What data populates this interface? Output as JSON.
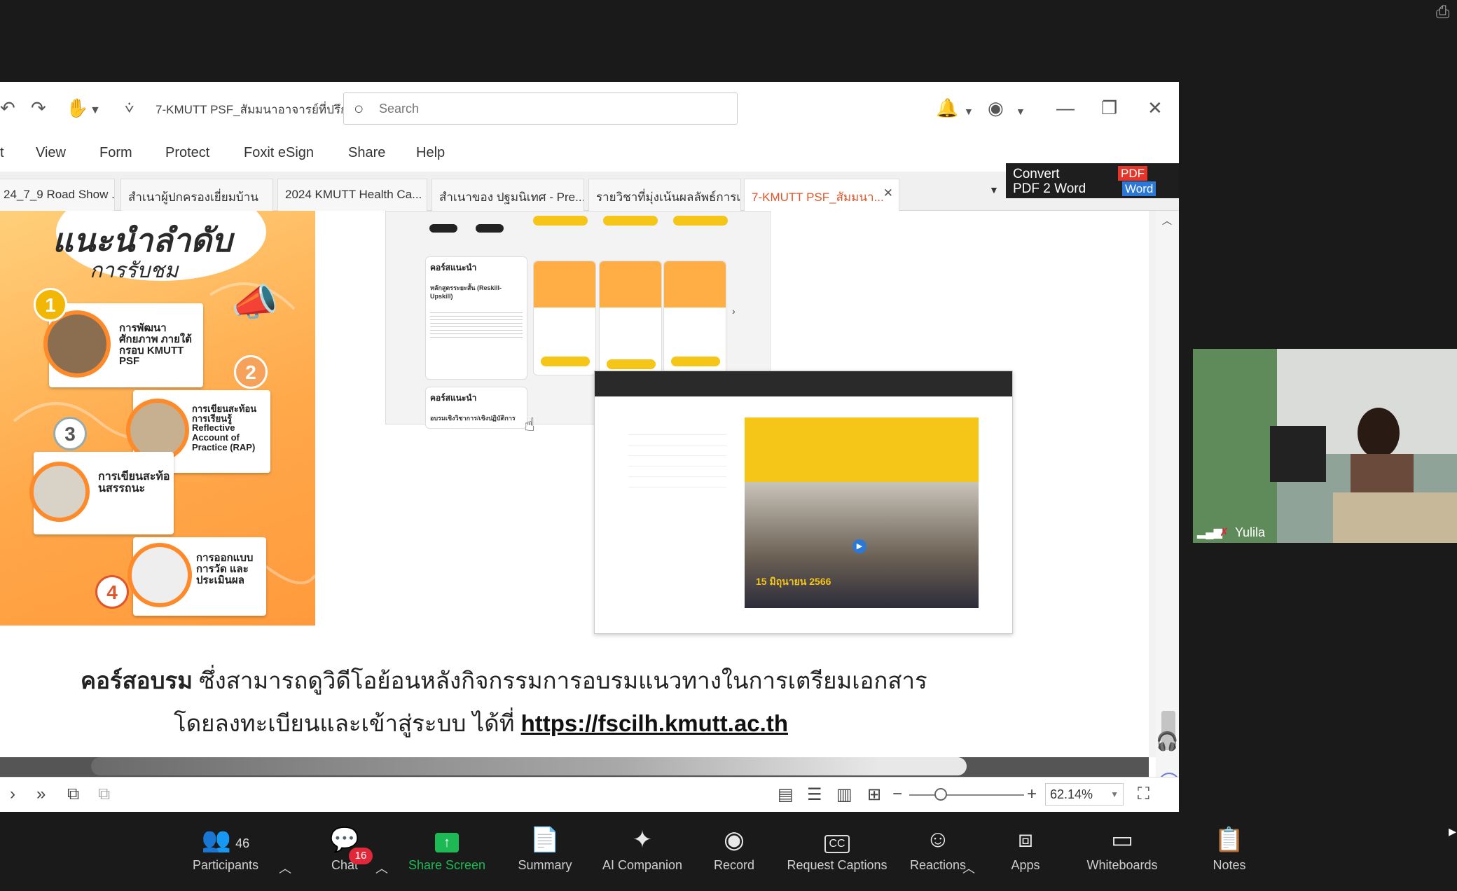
{
  "app": {
    "doc_title": "7-KMUTT PSF_สัมมนาอาจารย์ที่ปรึก...",
    "search_placeholder": "Search"
  },
  "menu": [
    "t",
    "View",
    "Form",
    "Protect",
    "Foxit eSign",
    "Share",
    "Help"
  ],
  "tabs": [
    {
      "label": "24_7_9 Road Show ..."
    },
    {
      "label": "สำเนาผู้ปกครองเยี่ยมบ้าน"
    },
    {
      "label": "2024 KMUTT Health Ca..."
    },
    {
      "label": "สำเนาของ ปฐมนิเทศ - Pre..."
    },
    {
      "label": "รายวิชาที่มุ่งเน้นผลลัพธ์การเ..."
    },
    {
      "label": "7-KMUTT PSF_สัมมนา...",
      "active": true
    }
  ],
  "convert_ad": {
    "line1": "Convert",
    "line2": "PDF 2 Word",
    "pdf": "PDF",
    "word": "Word"
  },
  "poster": {
    "title": "แนะนำลำดับ",
    "subtitle": "การรับชม",
    "card1": "การพัฒนาศักยภาพ ภายใต้กรอบ KMUTT PSF",
    "card2": "การเขียนสะท้อนการเรียนรู้ Reflective Account of Practice (RAP)",
    "card3": "การเขียนสะท้อนสรรถนะ",
    "card4": "การออกแบบการวัด และประเมินผล",
    "nums": [
      "1",
      "2",
      "3",
      "4"
    ]
  },
  "web1": {
    "heading1": "คอร์สแนะนำ",
    "sub1": "หลักสูตรระยะสั้น (Reskill-Upskill)",
    "heading2": "คอร์สแนะนำ",
    "sub2": "อบรมเชิงวิชาการ/เชิงปฏิบัติการ"
  },
  "web2": {
    "date_overlay": "15 มิถุนายน 2566"
  },
  "caption": {
    "bold": "คอร์สอบรม",
    "rest1": " ซึ่งสามารถดูวิดีโอย้อนหลังกิจกรรมการอบรมแนวทางในการเตรียมเอกสาร",
    "rest2": "โดยลงทะเบียนและเข้าสู่ระบบ ได้ที่ ",
    "link": "https://fscilh.kmutt.ac.th"
  },
  "status": {
    "zoom": "62.14%"
  },
  "video": {
    "name": "Yulila"
  },
  "zoom_toolbar": {
    "participants_count": "46",
    "chat_badge": "16",
    "buttons": [
      {
        "label": "Participants",
        "icon": "participants-icon"
      },
      {
        "label": "Chat",
        "icon": "chat-icon"
      },
      {
        "label": "Share Screen",
        "icon": "share-screen-icon"
      },
      {
        "label": "Summary",
        "icon": "summary-icon"
      },
      {
        "label": "AI Companion",
        "icon": "ai-companion-icon"
      },
      {
        "label": "Record",
        "icon": "record-icon"
      },
      {
        "label": "Request Captions",
        "icon": "captions-icon"
      },
      {
        "label": "Reactions",
        "icon": "reactions-icon"
      },
      {
        "label": "Apps",
        "icon": "apps-icon"
      },
      {
        "label": "Whiteboards",
        "icon": "whiteboards-icon"
      },
      {
        "label": "Notes",
        "icon": "notes-icon"
      }
    ]
  },
  "colors": {
    "share_green": "#1db954",
    "accent_orange": "#ff9a3c",
    "badge_red": "#e0283a"
  }
}
